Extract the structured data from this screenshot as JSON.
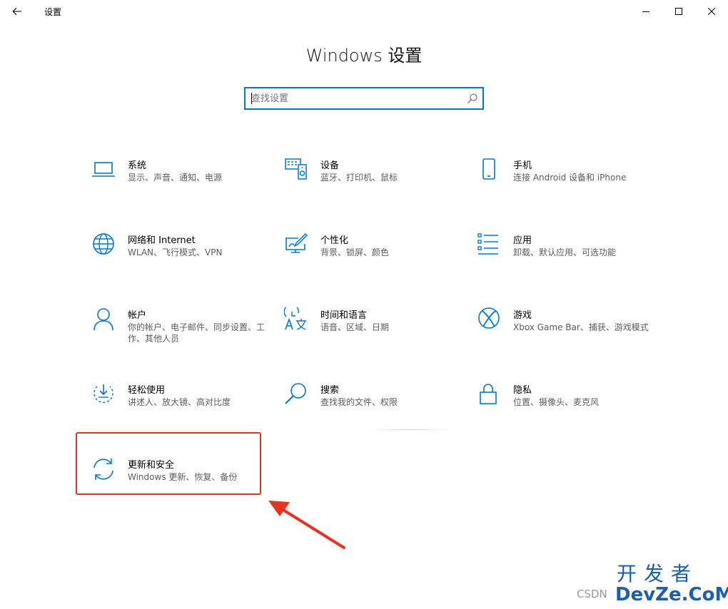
{
  "window": {
    "title": "设置"
  },
  "page_title": "Windows 设置",
  "search": {
    "placeholder": "查找设置",
    "value": ""
  },
  "tiles": [
    {
      "title": "系统",
      "desc": "显示、声音、通知、电源",
      "icon": "laptop-icon"
    },
    {
      "title": "设备",
      "desc": "蓝牙、打印机、鼠标",
      "icon": "devices-icon"
    },
    {
      "title": "手机",
      "desc": "连接 Android 设备和 iPhone",
      "icon": "phone-icon"
    },
    {
      "title": "网络和 Internet",
      "desc": "WLAN、飞行模式、VPN",
      "icon": "globe-icon"
    },
    {
      "title": "个性化",
      "desc": "背景、锁屏、颜色",
      "icon": "personalization-icon"
    },
    {
      "title": "应用",
      "desc": "卸载、默认应用、可选功能",
      "icon": "apps-list-icon"
    },
    {
      "title": "帐户",
      "desc": "你的帐户、电子邮件、同步设置、工作、其他人员",
      "icon": "person-icon"
    },
    {
      "title": "时间和语言",
      "desc": "语音、区域、日期",
      "icon": "time-language-icon"
    },
    {
      "title": "游戏",
      "desc": "Xbox Game Bar、捕获、游戏模式",
      "icon": "xbox-icon"
    },
    {
      "title": "轻松使用",
      "desc": "讲述人、放大镜、高对比度",
      "icon": "ease-of-access-icon"
    },
    {
      "title": "搜索",
      "desc": "查找我的文件、权限",
      "icon": "search-icon"
    },
    {
      "title": "隐私",
      "desc": "位置、摄像头、麦克风",
      "icon": "lock-icon"
    },
    {
      "title": "更新和安全",
      "desc": "Windows 更新、恢复、备份",
      "icon": "sync-icon"
    }
  ],
  "watermark": {
    "csdn": "CSDN",
    "logo_top": "开发者",
    "logo_bottom": "DevZe.CoM"
  },
  "colors": {
    "accent": "#0078d7",
    "annotation": "#e8321e"
  }
}
